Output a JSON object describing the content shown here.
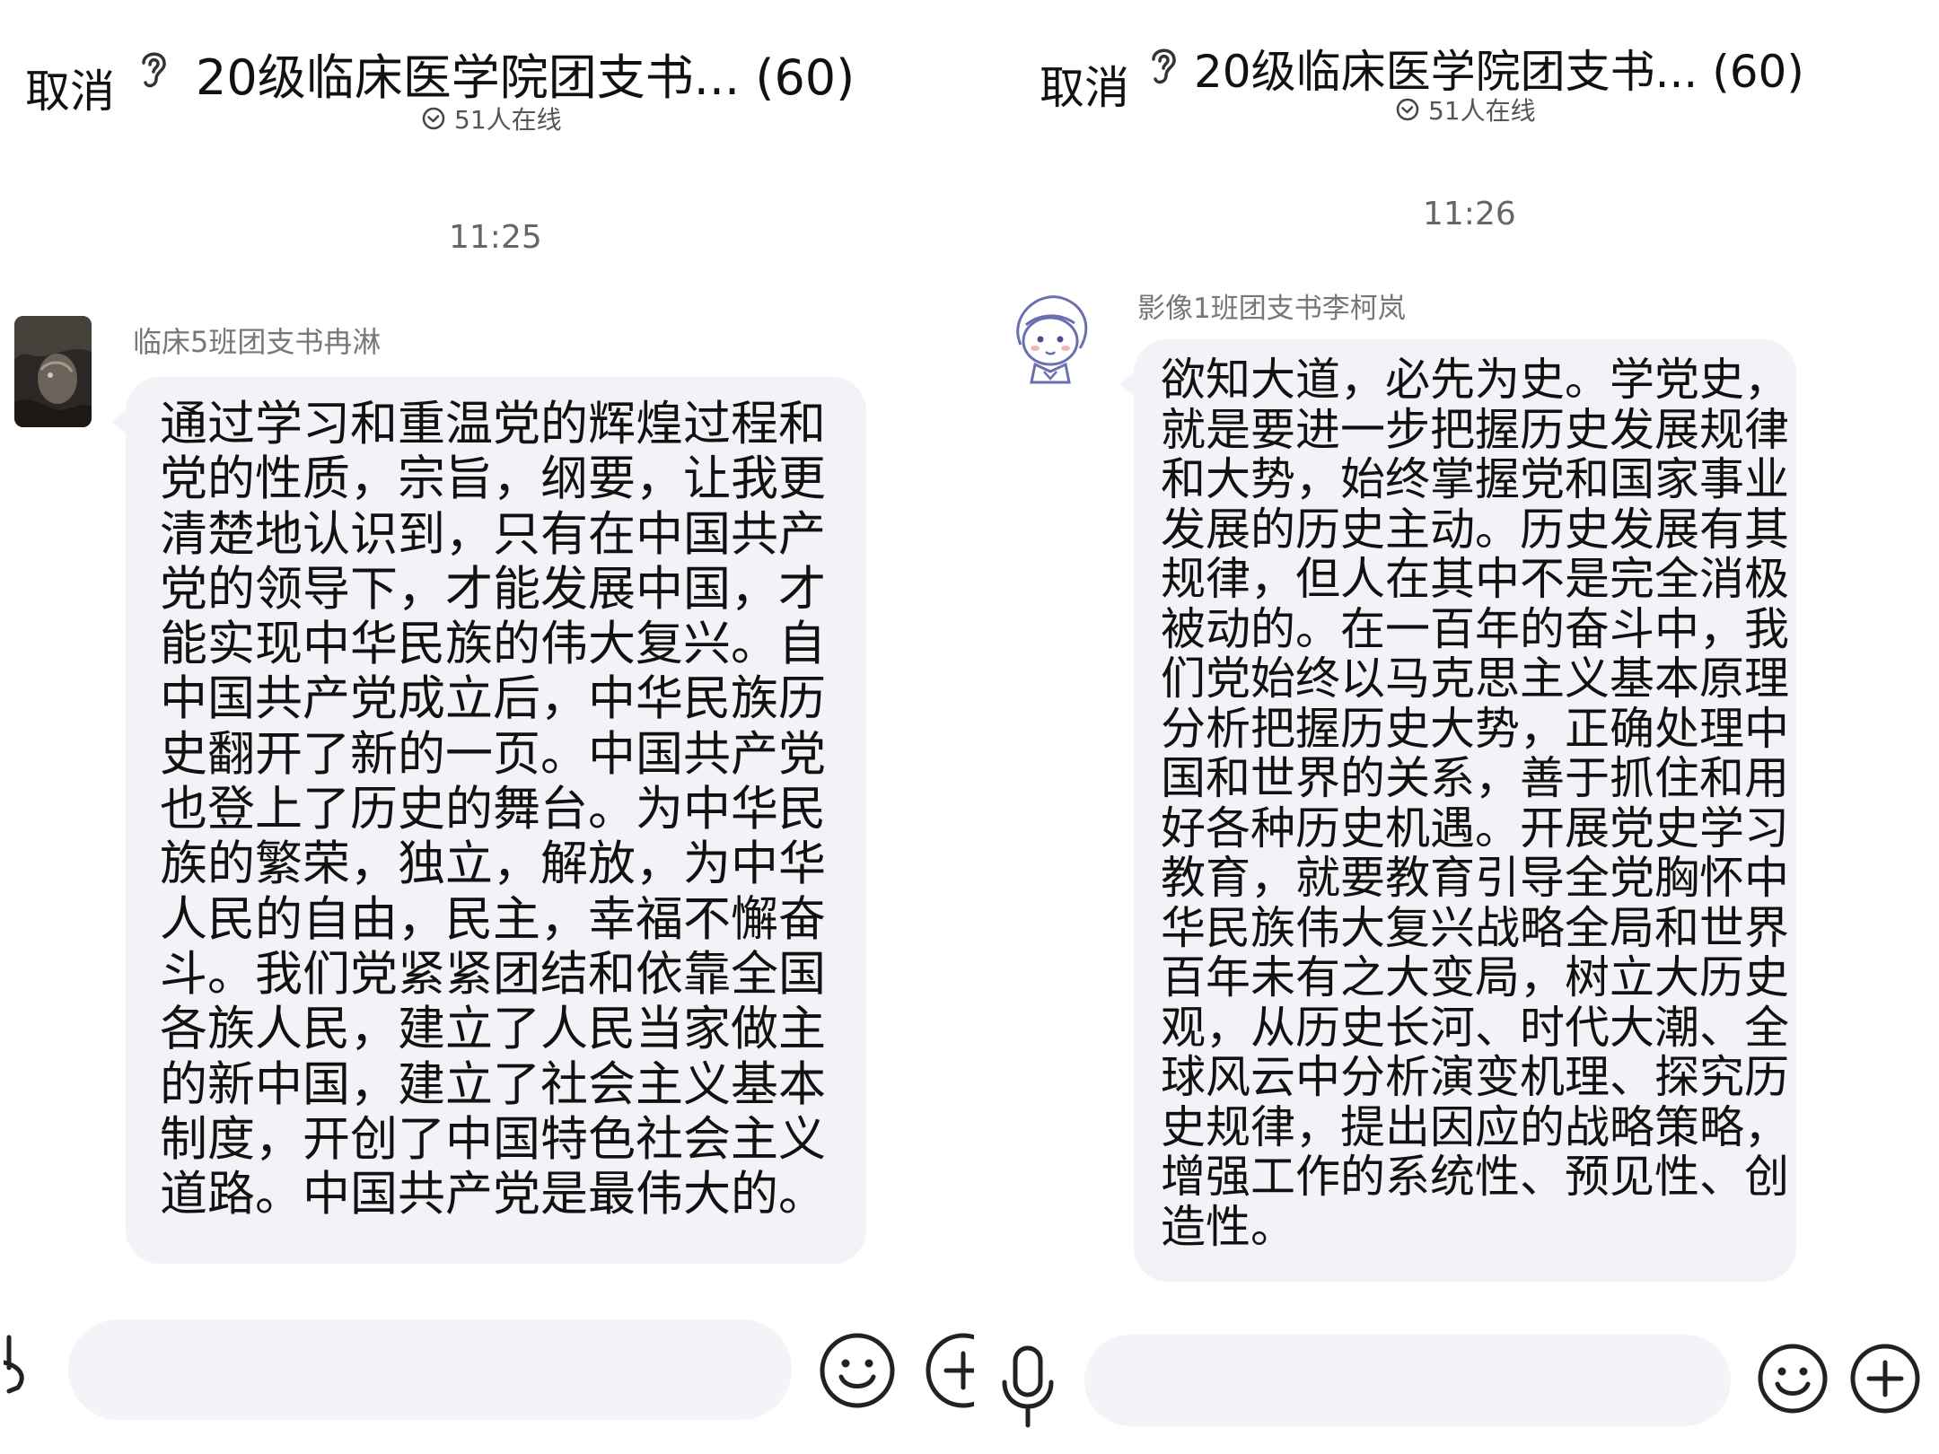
{
  "left": {
    "header": {
      "cancel_label": "取消",
      "title": "20级临床医学院团支书... (60)",
      "online": "51人在线"
    },
    "time": "11:25",
    "message": {
      "sender": "临床5班团支书冉淋",
      "text": "通过学习和重温党的辉煌过程和\n党的性质，宗旨，纲要，让我更\n清楚地认识到，只有在中国共产\n党的领导下，才能发展中国，才\n能实现中华民族的伟大复兴。自\n中国共产党成立后，中华民族历\n史翻开了新的一页。中国共产党\n也登上了历史的舞台。为中华民\n族的繁荣，独立，解放，为中华\n人民的自由，民主，幸福不懈奋\n斗。我们党紧紧团结和依靠全国\n各族人民，建立了人民当家做主\n的新中国，建立了社会主义基本\n制度，开创了中国特色社会主义\n道路。中国共产党是最伟大的。"
    }
  },
  "right": {
    "header": {
      "cancel_label": "取消",
      "title": "20级临床医学院团支书... (60)",
      "online": "51人在线"
    },
    "time": "11:26",
    "message": {
      "sender": "影像1班团支书李柯岚",
      "text": "欲知大道，必先为史。学党史，\n就是要进一步把握历史发展规律\n和大势，始终掌握党和国家事业\n发展的历史主动。历史发展有其\n规律，但人在其中不是完全消极\n被动的。在一百年的奋斗中，我\n们党始终以马克思主义基本原理\n分析把握历史大势，正确处理中\n国和世界的关系，善于抓住和用\n好各种历史机遇。开展党史学习\n教育，就要教育引导全党胸怀中\n华民族伟大复兴战略全局和世界\n百年未有之大变局，树立大历史\n观，从历史长河、时代大潮、全\n球风云中分析演变机理、探究历\n史规律，提出因应的战略策略，\n增强工作的系统性、预见性、创\n造性。"
    }
  },
  "icons": {
    "ear": "ear-icon",
    "online_status": "check-circle-icon",
    "voice": "microphone-icon",
    "emoji": "smiley-icon",
    "add": "plus-circle-icon"
  },
  "colors": {
    "bubble": "#f2f2f7",
    "input": "#f4f4f8",
    "text": "#111111",
    "meta": "#666666"
  }
}
